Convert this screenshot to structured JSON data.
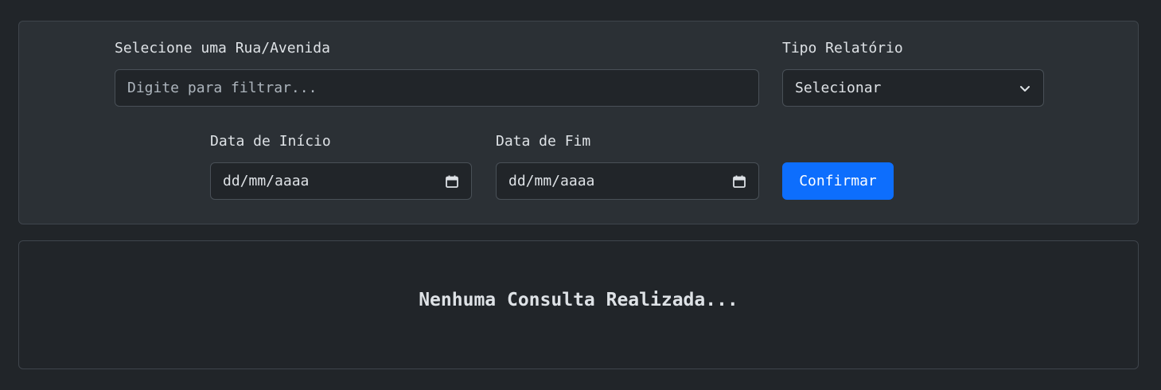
{
  "filters": {
    "street_label": "Selecione uma Rua/Avenida",
    "street_placeholder": "Digite para filtrar...",
    "report_type_label": "Tipo Relatório",
    "report_type_value": "Selecionar",
    "start_date_label": "Data de Início",
    "start_date_placeholder": "dd/mm/aaaa",
    "end_date_label": "Data de Fim",
    "end_date_placeholder": "dd/mm/aaaa",
    "confirm_label": "Confirmar"
  },
  "results": {
    "empty_message": "Nenhuma Consulta Realizada..."
  },
  "colors": {
    "page_background": "#212529",
    "panel_background": "#2b3035",
    "primary_button": "#0d6efd",
    "border": "#495057",
    "text": "#dee2e6"
  },
  "icons": {
    "select_arrow": "chevron-down-icon",
    "date_picker": "calendar-icon"
  }
}
